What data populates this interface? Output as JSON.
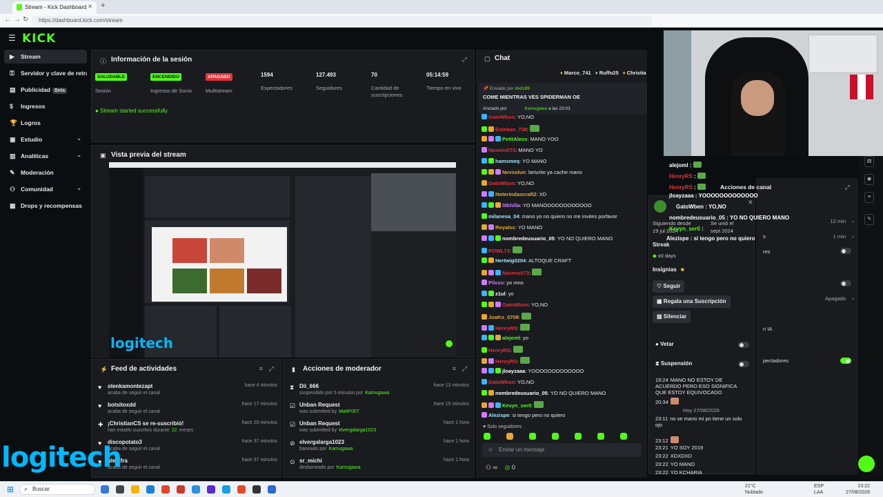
{
  "browser": {
    "tab_title": "Stream - Kick Dashboard",
    "url": "https://dashboard.kick.com/stream"
  },
  "brand": {
    "logo": "KICK",
    "accent": "#53fc18"
  },
  "sidebar": {
    "items": [
      {
        "label": "Stream",
        "icon": "play-circle-icon",
        "active": true
      },
      {
        "label": "Servidor y clave de retransmisión",
        "icon": "key-icon"
      },
      {
        "label": "Publicidad",
        "icon": "ad-icon",
        "badge": "Beta"
      },
      {
        "label": "Ingresos",
        "icon": "money-icon"
      },
      {
        "label": "Logros",
        "icon": "trophy-icon"
      },
      {
        "label": "Estudio",
        "icon": "studio-icon",
        "chevron": true
      },
      {
        "label": "Analíticas",
        "icon": "chart-icon",
        "chevron": true
      },
      {
        "label": "Moderación",
        "icon": "wrench-icon"
      },
      {
        "label": "Comunidad",
        "icon": "people-icon",
        "chevron": true
      },
      {
        "label": "Drops y recompensas",
        "icon": "gift-icon"
      }
    ]
  },
  "session": {
    "title": "Información de la sesión",
    "stats": [
      {
        "badge": "SALUDABLE",
        "badge_color": "#53fc18",
        "label": "Sesión"
      },
      {
        "badge": "ENCENDIDO",
        "badge_color": "#53fc18",
        "label": "Ingresos de Socio"
      },
      {
        "badge": "APAGADO",
        "badge_color": "#e5323b",
        "label": "Multistream"
      },
      {
        "value": "1594",
        "label": "Espectadores"
      },
      {
        "value": "127.493",
        "label": "Seguidores"
      },
      {
        "value": "70",
        "label": "Cantidad de suscripciones"
      },
      {
        "value": "05:14:59",
        "label": "Tiempo en vivo"
      }
    ],
    "status_message": "Stream started successfully."
  },
  "preview": {
    "title": "Vista previa del stream",
    "overlay_brand": "logitech"
  },
  "activity_feed": {
    "title": "Feed de actividades",
    "items": [
      {
        "icon": "heart-icon",
        "name": "olenkamontezapt",
        "desc": "acaba de seguir el canal",
        "time": "hace 4 minutos"
      },
      {
        "icon": "heart-icon",
        "name": "botsitoxdd",
        "desc": "acaba de seguir el canal",
        "time": "hace 17 minutos"
      },
      {
        "icon": "star-icon",
        "name": "¡ChristianCS se re-suscribió!",
        "desc": "han estado suscritos durante",
        "highlight": "22",
        "desc2": "meses",
        "time": "hace 20 minutos"
      },
      {
        "icon": "heart-icon",
        "name": "discopotato3",
        "desc": "acaba de seguir el canal",
        "time": "hace 37 minutos"
      },
      {
        "icon": "heart-icon",
        "name": "ulestfra",
        "desc": "acaba de seguir el canal",
        "time": "hace 37 minutos"
      }
    ]
  },
  "mod_actions": {
    "title": "Acciones de moderador",
    "items": [
      {
        "icon": "hourglass-icon",
        "name": "Dii_666",
        "desc": "suspendido por 5 minutos por",
        "by": "Kamugawa",
        "time": "hace 13 minutos"
      },
      {
        "icon": "unban-icon",
        "name": "Unban Request",
        "desc": "was submitted by",
        "by": "MattF007",
        "time": "hace 15 minutos"
      },
      {
        "icon": "unban-icon",
        "name": "Unban Request",
        "desc": "was submitted by",
        "by": "elvergalarga1023",
        "time": "hace 1 hora"
      },
      {
        "icon": "ban-icon",
        "name": "elvergalarga1023",
        "desc": "baneado por",
        "by": "Kamugawa",
        "time": "hace 1 hora"
      },
      {
        "icon": "unban-circle-icon",
        "name": "sr_michi",
        "desc": "desbaneado por",
        "by": "Kamugawa",
        "time": "hace 1 hora"
      }
    ]
  },
  "chat": {
    "title": "Chat",
    "top_gifters": [
      "Marco_741",
      "Ruffo25",
      "Christia"
    ],
    "pinned": {
      "sent_by_label": "Enviado por",
      "sent_by": "dvd189",
      "message": "COME MIENTRAS VES SPIDERMAN OE",
      "pinned_by_label": "Anclado por",
      "pinned_by": "Kamugawa",
      "pinned_time": "a las 23:03"
    },
    "messages": [
      {
        "user": "GatoWbon",
        "color": "#e5323b",
        "text": "YO,NO"
      },
      {
        "user": "Esteban_738",
        "color": "#e5323b",
        "text": ""
      },
      {
        "user": "PetitAless",
        "color": "#53fc18",
        "text": "MANO YOO"
      },
      {
        "user": "Nasmix073",
        "color": "#e5323b",
        "text": "MANO YO"
      },
      {
        "user": "hamsmeq",
        "color": "#9ee6ff",
        "text": "YO MANO"
      },
      {
        "user": "Nevsolun",
        "color": "#e5a933",
        "text": "larturito ya cache mano"
      },
      {
        "user": "GatoWbon",
        "color": "#e5323b",
        "text": "YO,NO"
      },
      {
        "user": "Noterindascraft2",
        "color": "#e5a933",
        "text": "XD"
      },
      {
        "user": "litkhilla",
        "color": "#d07bff",
        "text": "YO MANOOOOOOOOOOOO"
      },
      {
        "user": "milanesa_04",
        "color": "#9ee6ff",
        "text": "mano yo no quiero no me invites porfavor"
      },
      {
        "user": "Royalsc",
        "color": "#e5a933",
        "text": "YO MANO"
      },
      {
        "user": "nombredeusuario_05",
        "color": "#ffffff",
        "text": "YO NO QUIERO MANO"
      },
      {
        "user": "POWL73",
        "color": "#e5323b",
        "text": ""
      },
      {
        "user": "Hertwig0204",
        "color": "#9ee6ff",
        "text": "ALTOQUE CRAFT"
      },
      {
        "user": "Nasmix073",
        "color": "#e5323b",
        "text": ""
      },
      {
        "user": "Pilxxu",
        "color": "#d07bff",
        "text": "yo mno"
      },
      {
        "user": "z1ul",
        "color": "#ffffff",
        "text": "yo"
      },
      {
        "user": "GatoWbon",
        "color": "#e5323b",
        "text": "YO,NO"
      },
      {
        "user": "JoaKo_0708",
        "color": "#e5a933",
        "text": ""
      },
      {
        "user": "HenryRS",
        "color": "#e5323b",
        "text": ""
      },
      {
        "user": "alejoml",
        "color": "#53fc18",
        "text": "yo"
      },
      {
        "user": "HenryRS",
        "color": "#e5323b",
        "text": ""
      },
      {
        "user": "HenryRS",
        "color": "#e5323b",
        "text": ""
      },
      {
        "user": "jloayzaaa",
        "color": "#ffffff",
        "text": "YOOOOOOOOOOOOO"
      },
      {
        "user": "GatoWbon",
        "color": "#e5323b",
        "text": "YO,NO"
      },
      {
        "user": "nombredeusuario_05",
        "color": "#ffffff",
        "text": "YO NO QUIERO MANO"
      },
      {
        "user": "Kevyn_ser0",
        "color": "#53fc18",
        "text": ""
      },
      {
        "user": "Alezispe",
        "color": "#9ee6ff",
        "text": "si tengo pero no quiero"
      }
    ],
    "followers_only": "Solo seguidores",
    "input_placeholder": "Enviar un mensaje",
    "footer_count": "0"
  },
  "user_card": {
    "overlay_lines": [
      {
        "user": "jloayzaaa",
        "text": "YOOOOOOOOOOOOO"
      },
      {
        "user": "GatoWben",
        "text": "YO,NO"
      },
      {
        "user": "nombredeusuario_05",
        "text": "YO NO QUIERO MANO"
      },
      {
        "user": "Kevyn_ser0",
        "text": ""
      },
      {
        "user": "Alezispe",
        "text": "si tengo pero no quiero"
      }
    ],
    "following_since_label": "Siguiendo desde",
    "following_since": "19 jul 2024",
    "subscribed_label": "Se unió el",
    "subscribed": "sept 2024",
    "streak_label": "Streak",
    "streak_value": "x0 days",
    "insignias_label": "Insignias",
    "follow_button": "Seguir",
    "gift_button": "Regala una Suscripción",
    "mute_button": "Silenciar",
    "veto_label": "Vetar",
    "suspend_label": "Suspensión",
    "history": [
      {
        "time": "19:24",
        "text": "MANO NO ESTOY DE ACUERDO PERO ESO SIGNIFICA QUE ESTOY EQUIVOCADO"
      },
      {
        "time": "20:34",
        "text": ""
      },
      {
        "divider": "Hoy 27/08/2026"
      },
      {
        "time": "23:11",
        "text": "no se mano mi pn tiene un solo ojo"
      },
      {
        "time": "23:12",
        "text": ""
      },
      {
        "time": "23:21",
        "text": "YO SOY 2019"
      },
      {
        "time": "23:22",
        "text": "XDXDXD"
      },
      {
        "time": "23:22",
        "text": "YO MANO"
      },
      {
        "time": "23:22",
        "text": "YO KCHARIA"
      }
    ]
  },
  "right_panel": {
    "top_lines": [
      {
        "user": "alejoml",
        "text": ""
      },
      {
        "user": "HenryRS",
        "text": ""
      },
      {
        "user": "HenryRS",
        "text": ""
      }
    ],
    "title": "Acciones de canal",
    "rows": [
      {
        "label": "",
        "value": "12 min"
      },
      {
        "label": "s",
        "value": "1 min"
      },
      {
        "label": "res",
        "value": ""
      },
      {
        "label": "",
        "value": ""
      },
      {
        "label": "",
        "value": "Apagado"
      },
      {
        "label": "n IA",
        "value": ""
      },
      {
        "label": "pectadores",
        "value": ""
      }
    ]
  },
  "taskbar": {
    "search": "Buscar",
    "weather_temp": "21°C",
    "weather_desc": "Nublado",
    "lang": "ESP",
    "lang2": "LAA",
    "time": "23:22",
    "date": "27/08/2026"
  },
  "overlay_brand": "logitech"
}
